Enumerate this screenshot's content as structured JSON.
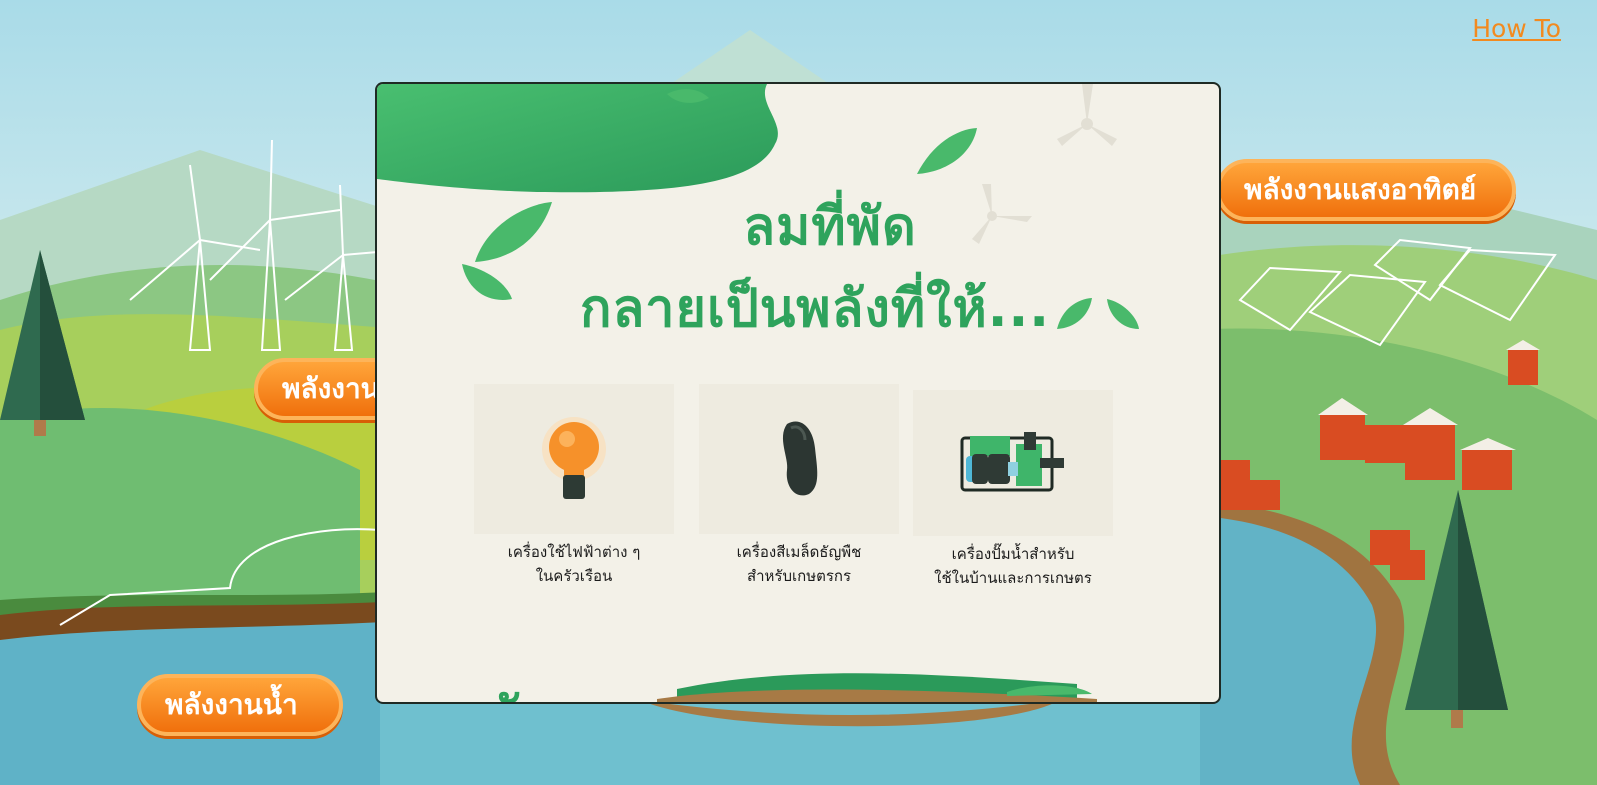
{
  "header": {
    "howto_label": "How To"
  },
  "map": {
    "solar_label": "พลังงานแสงอาทิตย์",
    "wind_label": "พลังงานลม",
    "water_label": "พลังงานน้ำ"
  },
  "modal": {
    "headline_line1": "ลมที่พัด",
    "headline_line2": "กลายเป็นพลังที่ให้...",
    "section_peek": "ลังงาน",
    "cards": [
      {
        "caption_line1": "เครื่องใช้ไฟฟ้าต่าง ๆ",
        "caption_line2": "ในครัวเรือน",
        "icon": "light-bulb-icon"
      },
      {
        "caption_line1": "เครื่องสีเมล็ดธัญพืช",
        "caption_line2": "สำหรับเกษตรกร",
        "icon": "grain-mill-icon"
      },
      {
        "caption_line1": "เครื่องปั๊มน้ำสำหรับ",
        "caption_line2": "ใช้ในบ้านและการเกษตร",
        "icon": "water-pump-icon"
      }
    ]
  },
  "colors": {
    "accent_orange": "#f0700c",
    "headline_green": "#2ea35c",
    "modal_bg": "#f3f1e8",
    "water_blue": "#5fb6c9"
  }
}
